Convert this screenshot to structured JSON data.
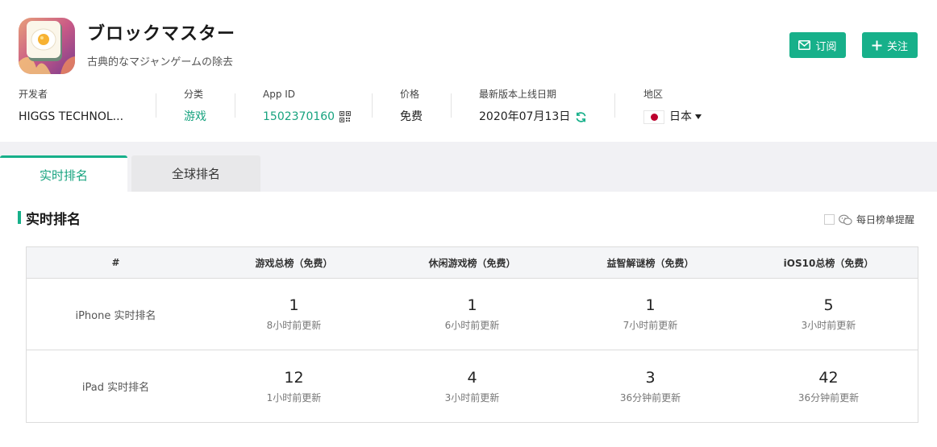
{
  "app": {
    "title": "ブロックマスター",
    "subtitle": "古典的なマジャンゲームの除去",
    "icon": "egg-mahjong-tile-icon"
  },
  "actions": {
    "subscribe_label": "订阅",
    "follow_label": "关注"
  },
  "info": {
    "developer_label": "开发者",
    "developer_value": "HIGGS TECHNOL...",
    "category_label": "分类",
    "category_value": "游戏",
    "appid_label": "App ID",
    "appid_value": "1502370160",
    "price_label": "价格",
    "price_value": "免费",
    "release_label": "最新版本上线日期",
    "release_value": "2020年07月13日",
    "region_label": "地区",
    "region_value": "日本"
  },
  "tabs": [
    {
      "label": "实时排名",
      "active": true
    },
    {
      "label": "全球排名",
      "active": false
    }
  ],
  "section": {
    "title": "实时排名",
    "reminder_label": "每日榜单提醒"
  },
  "table": {
    "headers": [
      "#",
      "游戏总榜（免费）",
      "休闲游戏榜（免费）",
      "益智解谜榜（免费）",
      "iOS10总榜（免费）"
    ],
    "rows": [
      {
        "label": "iPhone 实时排名",
        "cells": [
          {
            "rank": "1",
            "updated": "8小时前更新"
          },
          {
            "rank": "1",
            "updated": "6小时前更新"
          },
          {
            "rank": "1",
            "updated": "7小时前更新"
          },
          {
            "rank": "5",
            "updated": "3小时前更新"
          }
        ]
      },
      {
        "label": "iPad 实时排名",
        "cells": [
          {
            "rank": "12",
            "updated": "1小时前更新"
          },
          {
            "rank": "4",
            "updated": "3小时前更新"
          },
          {
            "rank": "3",
            "updated": "36分钟前更新"
          },
          {
            "rank": "42",
            "updated": "36分钟前更新"
          }
        ]
      }
    ]
  },
  "colors": {
    "accent": "#17b08a",
    "accent_text": "#17a37f",
    "flag_red": "#bc002d"
  }
}
